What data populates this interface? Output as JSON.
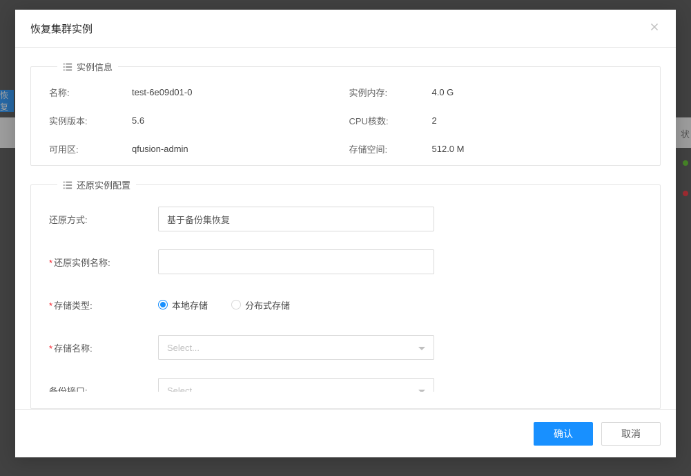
{
  "background": {
    "left_button_fragment": "恢复",
    "right_header_fragment": "状"
  },
  "modal": {
    "title": "恢复集群实例",
    "section_info_title": "实例信息",
    "section_config_title": "还原实例配置",
    "info": {
      "name_label": "名称:",
      "name_value": "test-6e09d01-0",
      "version_label": "实例版本:",
      "version_value": "5.6",
      "zone_label": "可用区:",
      "zone_value": "qfusion-admin",
      "memory_label": "实例内存:",
      "memory_value": "4.0 G",
      "cpu_label": "CPU核数:",
      "cpu_value": "2",
      "storage_label": "存储空间:",
      "storage_value": "512.0 M"
    },
    "form": {
      "restore_method_label": "还原方式:",
      "restore_method_value": "基于备份集恢复",
      "restore_name_label": "还原实例名称:",
      "restore_name_value": "",
      "storage_type_label": "存储类型:",
      "storage_type_options": {
        "local": "本地存储",
        "distributed": "分布式存储"
      },
      "storage_type_selected": "local",
      "storage_name_label": "存储名称:",
      "storage_name_placeholder": "Select...",
      "backup_port_label": "备份接口:",
      "backup_port_placeholder": "Select..."
    },
    "footer": {
      "ok": "确认",
      "cancel": "取消"
    }
  }
}
